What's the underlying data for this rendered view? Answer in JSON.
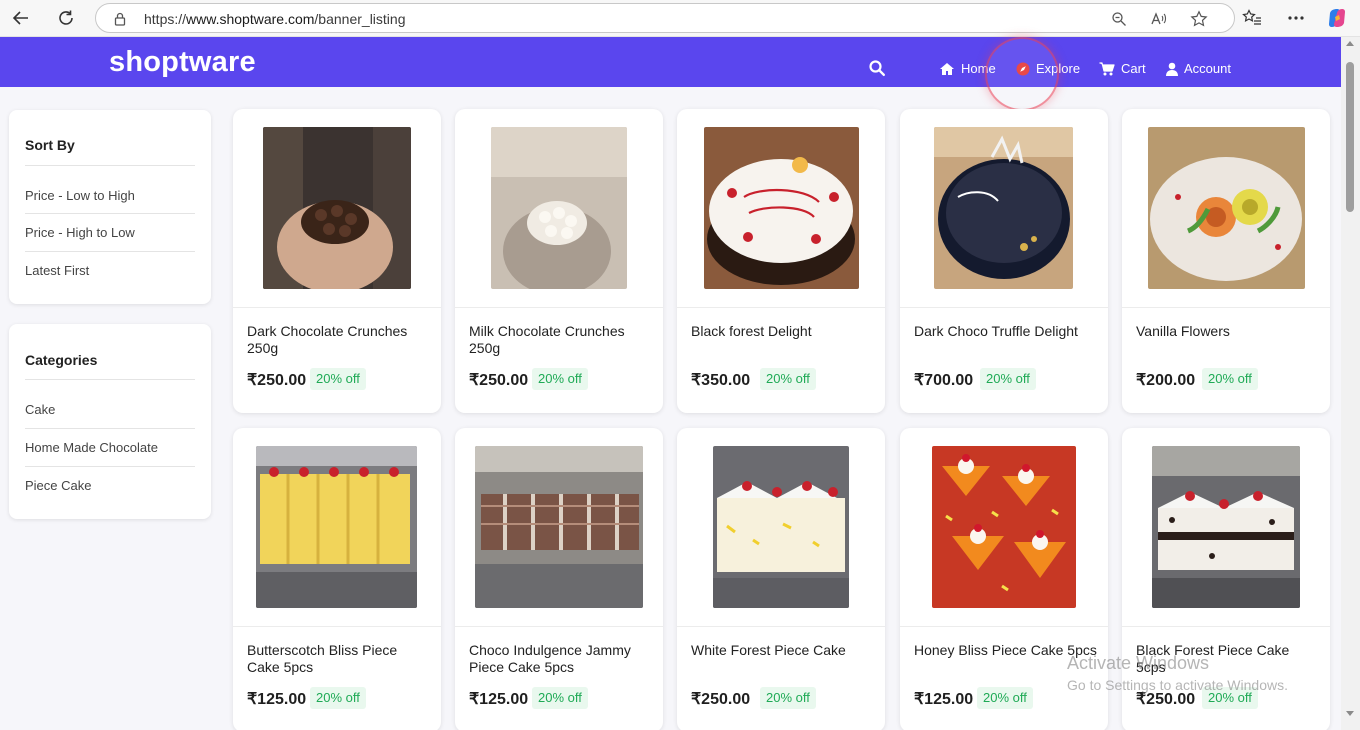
{
  "browser": {
    "url_prefix": "https://",
    "url_host": "www.shoptware.com",
    "url_path": "/banner_listing"
  },
  "header": {
    "logo": "shoptware",
    "nav": [
      {
        "label": "Home",
        "icon": "home-icon"
      },
      {
        "label": "Explore",
        "icon": "compass-icon"
      },
      {
        "label": "Cart",
        "icon": "cart-icon"
      },
      {
        "label": "Account",
        "icon": "user-icon"
      }
    ],
    "accent_color": "#5a46ee"
  },
  "sidebar": {
    "sort": {
      "title": "Sort By",
      "options": [
        "Price - Low to High",
        "Price - High to Low",
        "Latest First"
      ]
    },
    "categories": {
      "title": "Categories",
      "items": [
        "Cake",
        "Home Made Chocolate",
        "Piece Cake"
      ]
    }
  },
  "products": [
    {
      "name": "Dark Chocolate Crunches 250g",
      "price": "₹250.00",
      "discount": "20% off"
    },
    {
      "name": "Milk Chocolate Crunches 250g",
      "price": "₹250.00",
      "discount": "20% off"
    },
    {
      "name": "Black forest Delight",
      "price": "₹350.00",
      "discount": "20% off"
    },
    {
      "name": "Dark Choco Truffle Delight",
      "price": "₹700.00",
      "discount": "20% off"
    },
    {
      "name": "Vanilla Flowers",
      "price": "₹200.00",
      "discount": "20% off"
    },
    {
      "name": "Butterscotch Bliss Piece Cake 5pcs",
      "price": "₹125.00",
      "discount": "20% off"
    },
    {
      "name": "Choco Indulgence Jammy Piece Cake 5pcs",
      "price": "₹125.00",
      "discount": "20% off"
    },
    {
      "name": "White Forest Piece Cake",
      "price": "₹250.00",
      "discount": "20% off"
    },
    {
      "name": "Honey Bliss Piece Cake 5pcs",
      "price": "₹125.00",
      "discount": "20% off"
    },
    {
      "name": "Black Forest Piece Cake 5cps",
      "price": "₹250.00",
      "discount": "20% off"
    }
  ],
  "watermark": {
    "line1": "Activate Windows",
    "line2": "Go to Settings to activate Windows."
  }
}
